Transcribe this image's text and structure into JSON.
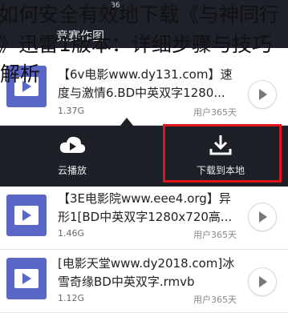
{
  "caption": {
    "line1": "如何安全有效地下载《与神同行",
    "line2": "》迅雷1版本：详细步骤与技巧",
    "line3": "解析"
  },
  "topbar": {
    "status": "36",
    "nav_title": "竞赛作图"
  },
  "items": [
    {
      "title": "【6v电影www.dy131.com】速度与激情6.BD中英双字1280...",
      "size": "1.37G",
      "source": "用户365天"
    },
    {
      "title": "【3E电影院www.eee4.org】异形1[BD中英双字1280x720高...",
      "size": "1.46G",
      "source": "用户365天"
    },
    {
      "title": "[电影天堂www.dy2018.com]冰雪奇缘BD中英双字.rmvb",
      "size": "1.12G",
      "source": "用户365天"
    }
  ],
  "actions": {
    "cloud_play": "云播放",
    "download": "下载到本地"
  },
  "colors": {
    "highlight": "#e0141c",
    "dark_bar": "#1d2027",
    "thumb": "#5b66c9"
  },
  "icons": {
    "cloud": "cloud-play-icon",
    "download": "download-icon",
    "play": "play-icon"
  }
}
